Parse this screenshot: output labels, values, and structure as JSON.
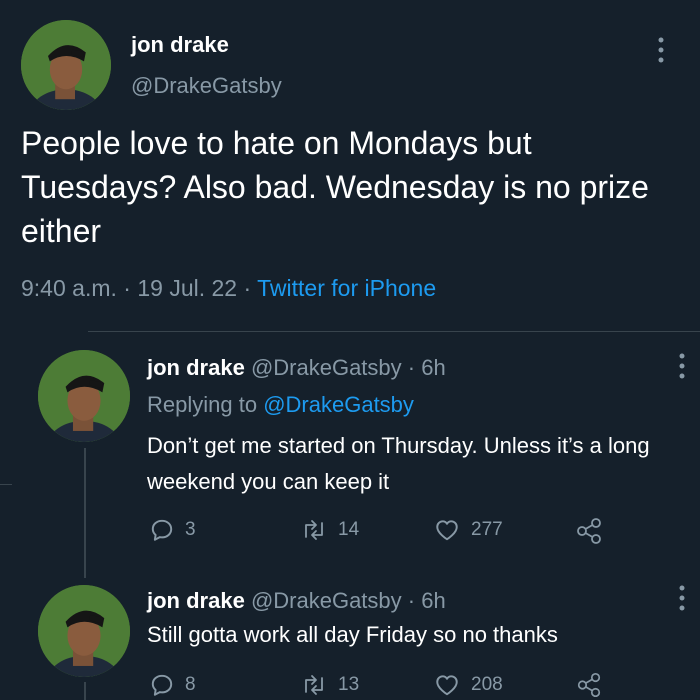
{
  "tweet": {
    "author_name": "jon drake",
    "author_handle": "@DrakeGatsby",
    "text": "People love to hate on Mondays but Tuesdays? Also bad. Wednesday is no prize either",
    "time": "9:40 a.m.",
    "date": "19 Jul. 22",
    "separator": "·",
    "source": "Twitter for iPhone",
    "more_icon": "more-vertical-icon"
  },
  "replies": [
    {
      "author_name": "jon drake",
      "author_handle": "@DrakeGatsby",
      "age": "· 6h",
      "replying_prefix": "Replying to",
      "replying_to": "@DrakeGatsby",
      "text": "Don’t get me started on Thursday. Unless it’s a long weekend you can keep it",
      "replies_count": "3",
      "retweets_count": "14",
      "likes_count": "277"
    },
    {
      "author_name": "jon drake",
      "author_handle": "@DrakeGatsby",
      "age": "· 6h",
      "text": "Still gotta work all day Friday so no thanks",
      "replies_count": "8",
      "retweets_count": "13",
      "likes_count": "208"
    }
  ],
  "colors": {
    "background": "#15202b",
    "primary_text": "#ffffff",
    "secondary_text": "#8899a6",
    "accent": "#1d9bf0",
    "divider": "#38444d"
  }
}
